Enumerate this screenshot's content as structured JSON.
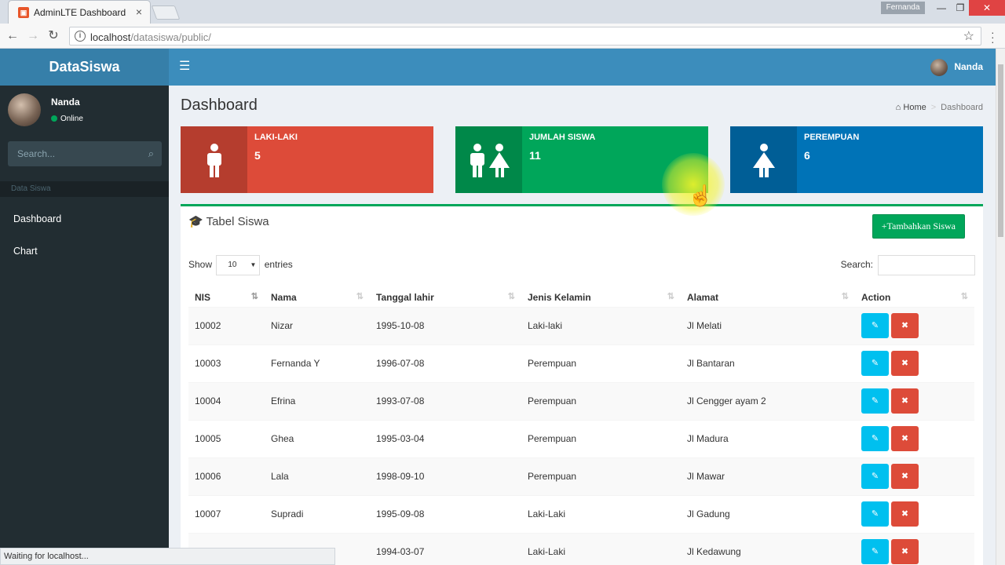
{
  "browser": {
    "tab_title": "AdminLTE Dashboard",
    "url_host": "localhost",
    "url_path": "/datasiswa/public/",
    "profile": "Fernanda",
    "status": "Waiting for localhost..."
  },
  "header": {
    "logo": "DataSiswa",
    "user_name": "Nanda"
  },
  "sidebar": {
    "user_name": "Nanda",
    "user_status": "Online",
    "search_placeholder": "Search...",
    "section_header": "Data Siswa",
    "items": [
      {
        "label": "Dashboard"
      },
      {
        "label": "Chart"
      }
    ]
  },
  "content": {
    "title": "Dashboard",
    "breadcrumb": {
      "home": "Home",
      "current": "Dashboard"
    }
  },
  "infoboxes": [
    {
      "label": "LAKI-LAKI",
      "value": "5",
      "color": "#dd4b39",
      "icon": "male-icon"
    },
    {
      "label": "JUMLAH SISWA",
      "value": "11",
      "color": "#00a65a",
      "icon": "people-icon"
    },
    {
      "label": "PEREMPUAN",
      "value": "6",
      "color": "#0073b7",
      "icon": "female-icon"
    }
  ],
  "table_box": {
    "title": "Tabel Siswa",
    "add_button": "+Tambahkan Siswa",
    "show_label": "Show",
    "entries_label": "entries",
    "page_size": "10",
    "search_label": "Search:",
    "columns": [
      "NIS",
      "Nama",
      "Tanggal lahir",
      "Jenis Kelamin",
      "Alamat",
      "Action"
    ],
    "rows": [
      [
        "10002",
        "Nizar",
        "1995-10-08",
        "Laki-laki",
        "Jl Melati"
      ],
      [
        "10003",
        "Fernanda Y",
        "1996-07-08",
        "Perempuan",
        "Jl Bantaran"
      ],
      [
        "10004",
        "Efrina",
        "1993-07-08",
        "Perempuan",
        "Jl Cengger ayam 2"
      ],
      [
        "10005",
        "Ghea",
        "1995-03-04",
        "Perempuan",
        "Jl Madura"
      ],
      [
        "10006",
        "Lala",
        "1998-09-10",
        "Perempuan",
        "Jl Mawar"
      ],
      [
        "10007",
        "Supradi",
        "1995-09-08",
        "Laki-Laki",
        "Jl Gadung"
      ],
      [
        "",
        "",
        "1994-03-07",
        "Laki-Laki",
        "Jl Kedawung"
      ]
    ]
  }
}
